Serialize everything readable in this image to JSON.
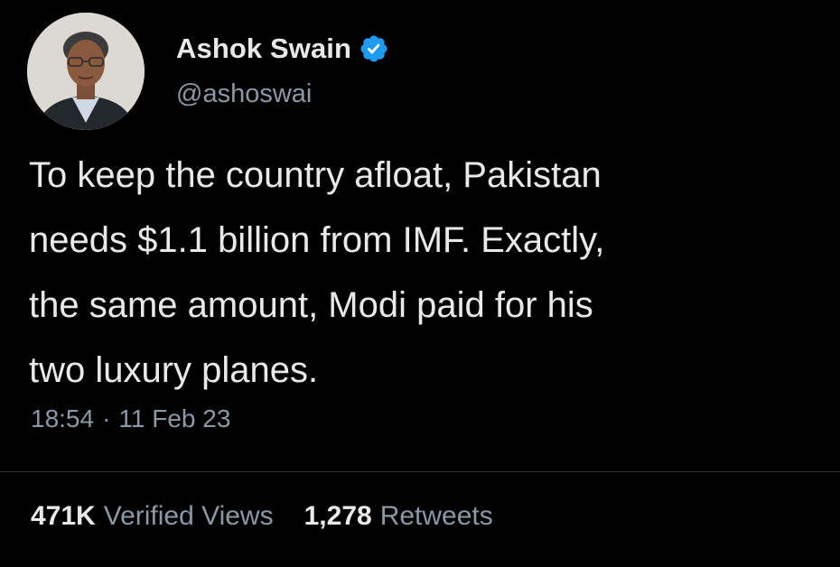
{
  "author": {
    "display_name": "Ashok Swain",
    "handle": "@ashoswai",
    "verified": true,
    "verified_color": "#1d9bf0",
    "avatar": "avatar-photo"
  },
  "tweet": {
    "text": "To keep the country afloat, Pakistan\nneeds $1.1 billion from IMF. Exactly,\nthe same amount, Modi paid for his\ntwo luxury planes.",
    "time": "18:54",
    "separator": "·",
    "date": "11 Feb 23"
  },
  "stats": {
    "views_count": "471K",
    "views_label": "Verified Views",
    "retweets_count": "1,278",
    "retweets_label": "Retweets"
  },
  "colors": {
    "background": "#000000",
    "primary_text": "#e7e9ea",
    "secondary_text": "#8b98a5",
    "divider": "#2f3336"
  }
}
